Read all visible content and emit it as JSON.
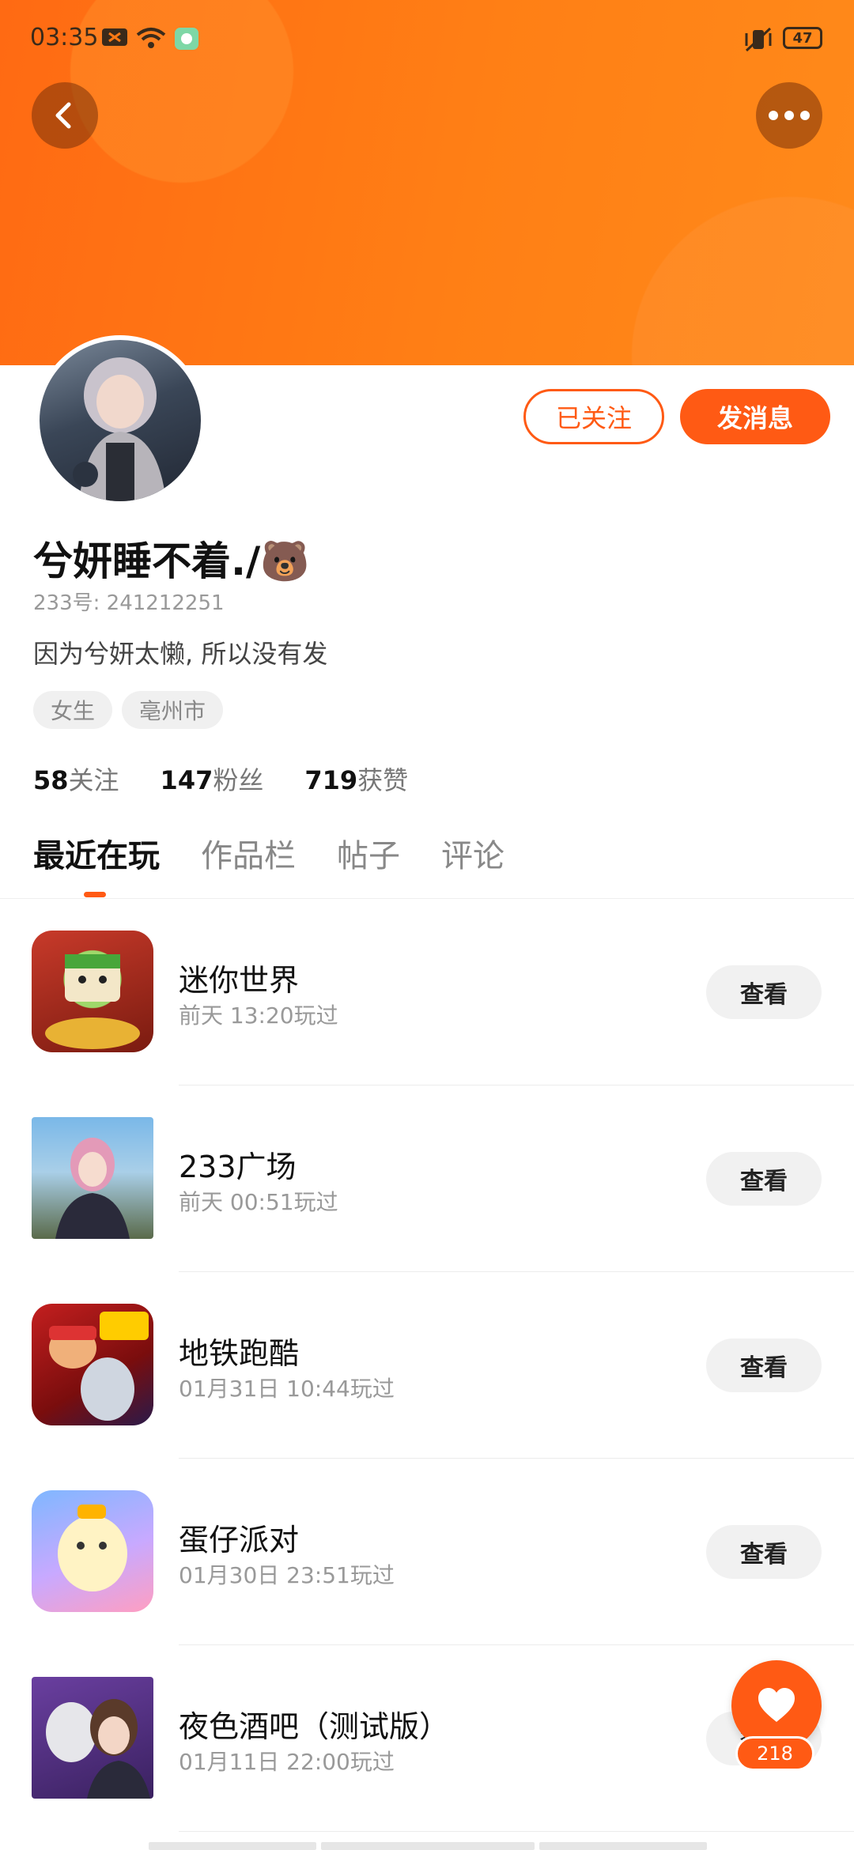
{
  "status_bar": {
    "time": "03:35",
    "battery": "47"
  },
  "profile": {
    "name": "兮妍睡不着./🐻",
    "id_text": "233号: 241212251",
    "bio": "因为兮妍太懒, 所以没有发",
    "tags": [
      "女生",
      "亳州市"
    ],
    "follow_label": "已关注",
    "message_label": "发消息"
  },
  "stats": [
    {
      "num": "58",
      "label": "关注"
    },
    {
      "num": "147",
      "label": "粉丝"
    },
    {
      "num": "719",
      "label": "获赞"
    }
  ],
  "tabs": [
    "最近在玩",
    "作品栏",
    "帖子",
    "评论"
  ],
  "games": [
    {
      "title": "迷你世界",
      "played": "前天 13:20玩过",
      "action": "查看"
    },
    {
      "title": "233广场",
      "played": "前天 00:51玩过",
      "action": "查看"
    },
    {
      "title": "地铁跑酷",
      "played": "01月31日 10:44玩过",
      "action": "查看"
    },
    {
      "title": "蛋仔派对",
      "played": "01月30日 23:51玩过",
      "action": "查看"
    },
    {
      "title": "夜色酒吧（测试版）",
      "played": "01月11日 22:00玩过",
      "action": "查看"
    }
  ],
  "fab": {
    "count": "218"
  },
  "colors": {
    "accent": "#ff5a14",
    "banner": "#ff7a15"
  }
}
